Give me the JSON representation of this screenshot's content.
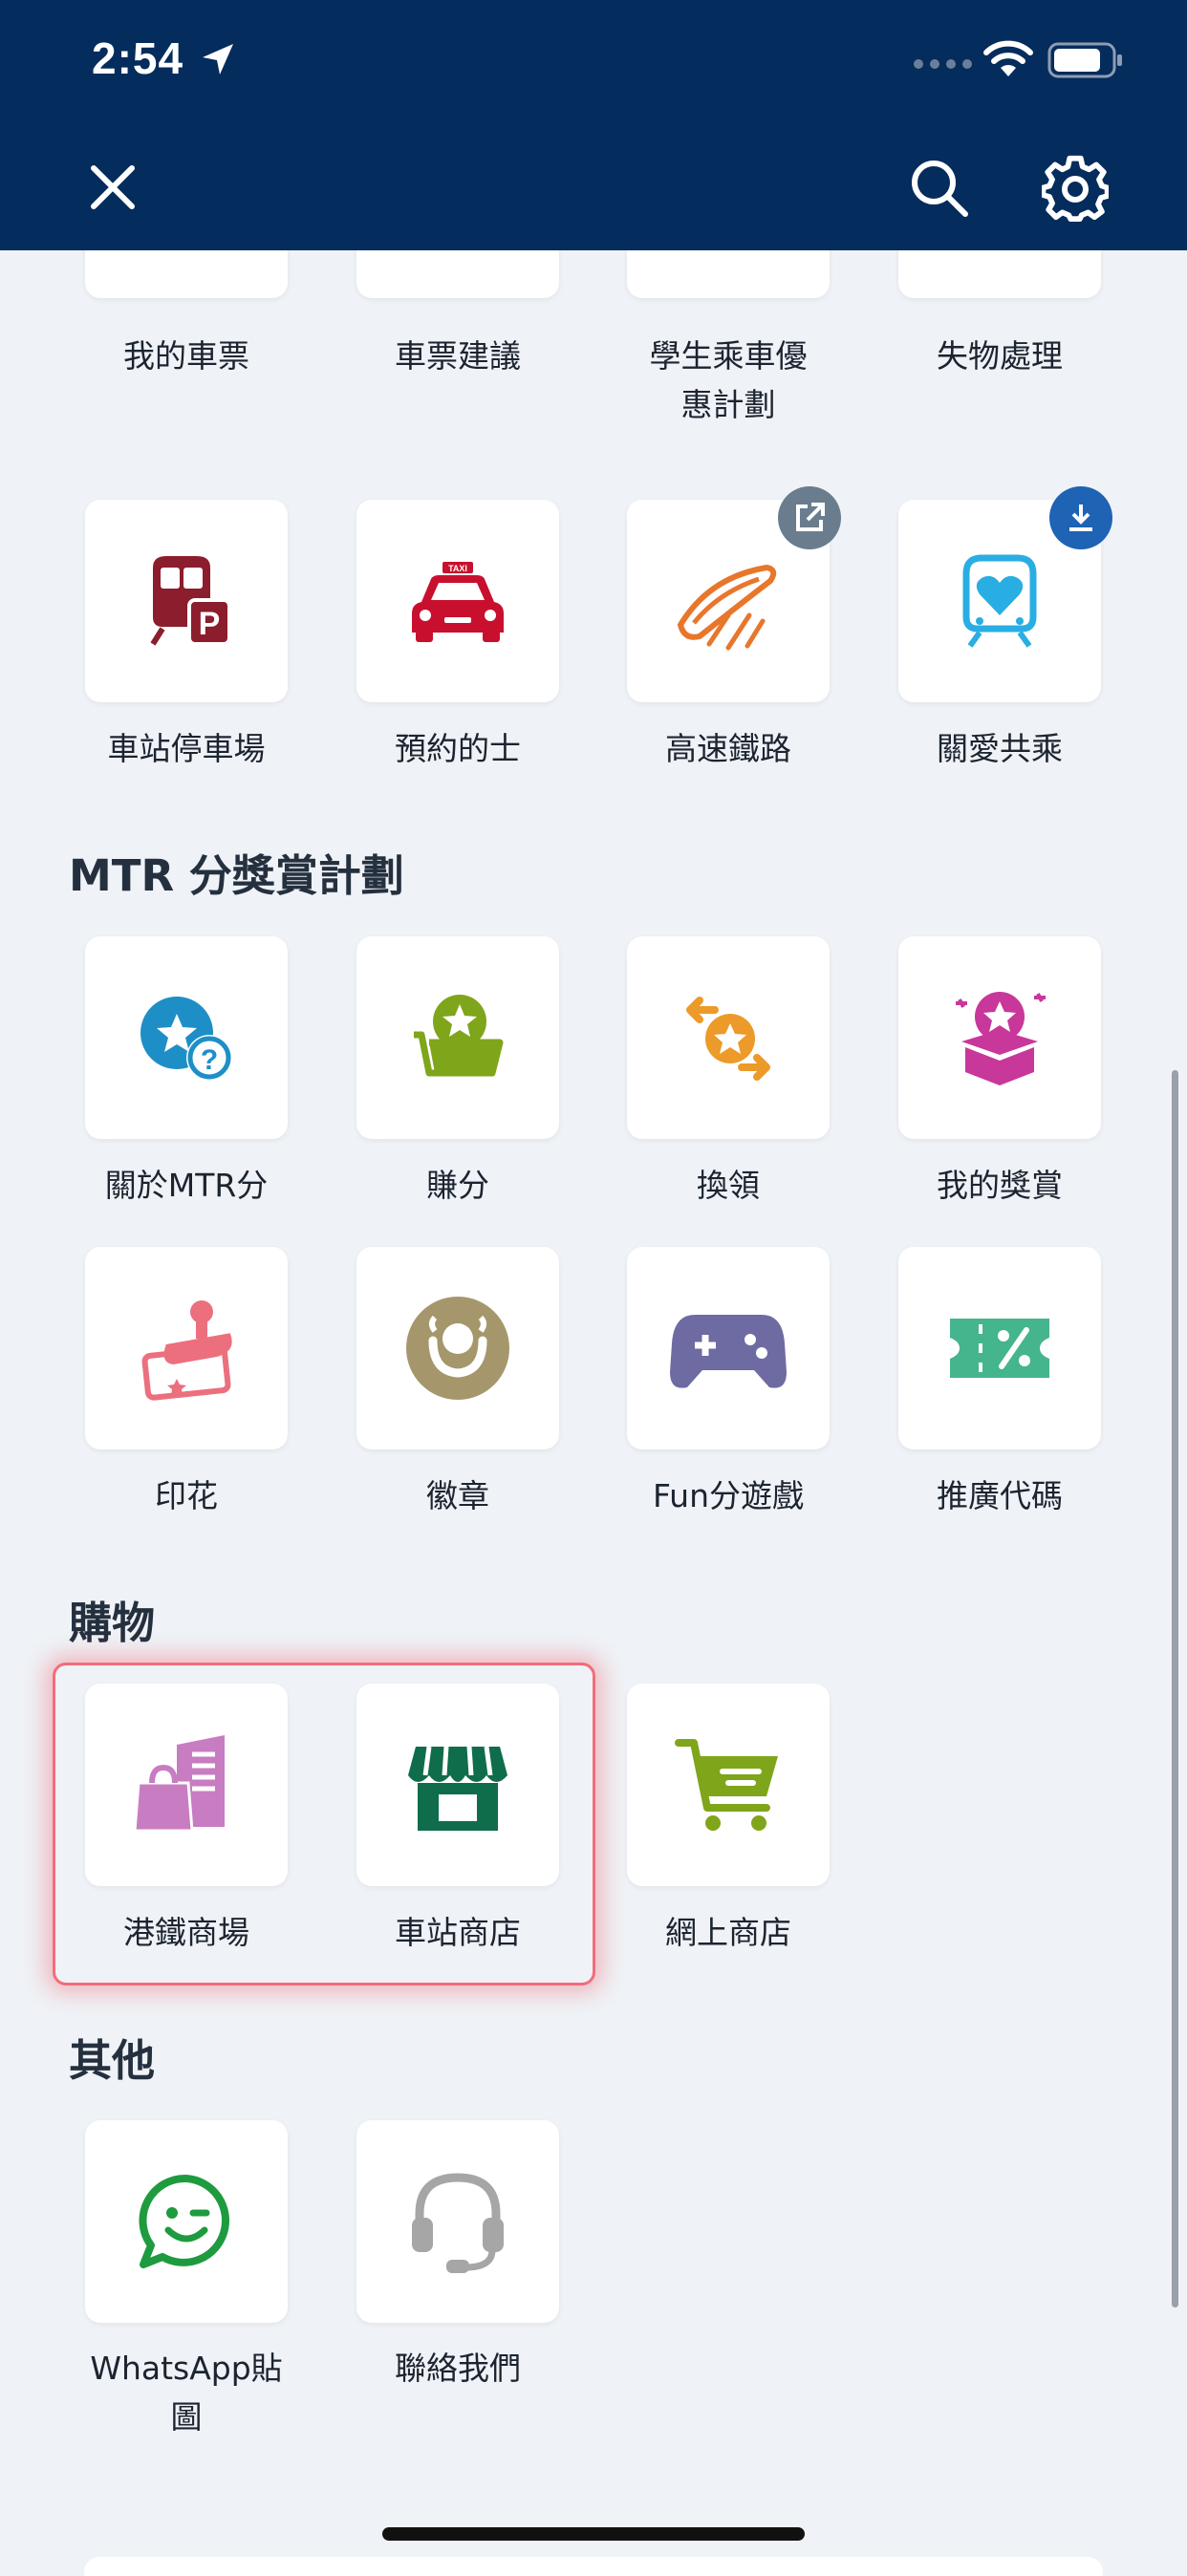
{
  "status_bar": {
    "time": "2:54"
  },
  "toolbar": {
    "close_icon": "close-icon",
    "search_icon": "search-icon",
    "settings_icon": "gear-icon"
  },
  "colors": {
    "header": "#042c5c",
    "background": "#eff2f6",
    "highlight": "#f26d78"
  },
  "top_items": [
    {
      "label": "我的車票",
      "icon": "ticket-icon"
    },
    {
      "label": "車票建議",
      "icon": "ticket-suggestion-icon"
    },
    {
      "label": "學生乘車優惠計劃",
      "line1": "學生乘車優",
      "line2": "惠計劃",
      "icon": "student-icon"
    },
    {
      "label": "失物處理",
      "icon": "lost-property-icon"
    }
  ],
  "services": [
    {
      "label": "車站停車場",
      "icon": "park-and-ride-icon"
    },
    {
      "label": "預約的士",
      "icon": "taxi-icon"
    },
    {
      "label": "高速鐵路",
      "icon": "high-speed-rail-icon",
      "badge": "external-link-icon"
    },
    {
      "label": "關愛共乘",
      "icon": "caring-ride-icon",
      "badge": "download-icon"
    }
  ],
  "rewards": {
    "title": "MTR 分獎賞計劃",
    "items": [
      {
        "label": "關於MTR分",
        "icon": "about-points-icon"
      },
      {
        "label": "賺分",
        "icon": "earn-points-icon"
      },
      {
        "label": "換領",
        "icon": "redeem-icon"
      },
      {
        "label": "我的獎賞",
        "icon": "my-rewards-icon"
      },
      {
        "label": "印花",
        "icon": "stamp-icon"
      },
      {
        "label": "徽章",
        "icon": "badge-icon"
      },
      {
        "label": "Fun分遊戲",
        "icon": "game-controller-icon"
      },
      {
        "label": "推廣代碼",
        "icon": "promo-code-icon"
      }
    ]
  },
  "shopping": {
    "title": "購物",
    "items": [
      {
        "label": "港鐵商場",
        "icon": "mall-icon"
      },
      {
        "label": "車站商店",
        "icon": "station-shop-icon"
      },
      {
        "label": "網上商店",
        "icon": "online-shop-icon"
      }
    ]
  },
  "others": {
    "title": "其他",
    "items": [
      {
        "label": "WhatsApp貼圖",
        "line1": "WhatsApp貼",
        "line2": "圖",
        "icon": "whatsapp-sticker-icon"
      },
      {
        "label": "聯絡我們",
        "icon": "contact-us-icon"
      }
    ]
  }
}
